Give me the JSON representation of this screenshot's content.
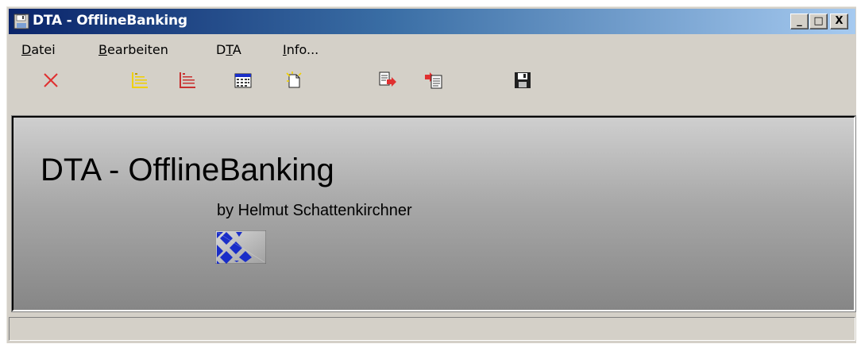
{
  "window": {
    "title": "DTA - OfflineBanking",
    "buttons": {
      "minimize": "_",
      "maximize": "□",
      "close": "X"
    }
  },
  "menu": {
    "items": [
      {
        "accel": "D",
        "rest": "atei"
      },
      {
        "accel": "B",
        "rest": "earbeiten"
      },
      {
        "pre": "D",
        "accel": "T",
        "rest": "A"
      },
      {
        "accel": "I",
        "rest": "nfo..."
      }
    ]
  },
  "toolbar": {
    "icons": [
      "delete-icon",
      "yellow-list-icon",
      "red-list-icon",
      "calendar-icon",
      "new-document-icon",
      "export-icon",
      "import-icon",
      "save-icon"
    ]
  },
  "main": {
    "title": "DTA - OfflineBanking",
    "byline": "by Helmut Schattenkirchner"
  },
  "status": {
    "text": ""
  },
  "colors": {
    "titlebar_start": "#0a246a",
    "titlebar_end": "#a6caf0",
    "face": "#d4d0c8",
    "delete_red": "#e03030",
    "logo_blue": "#1a2ec8"
  }
}
